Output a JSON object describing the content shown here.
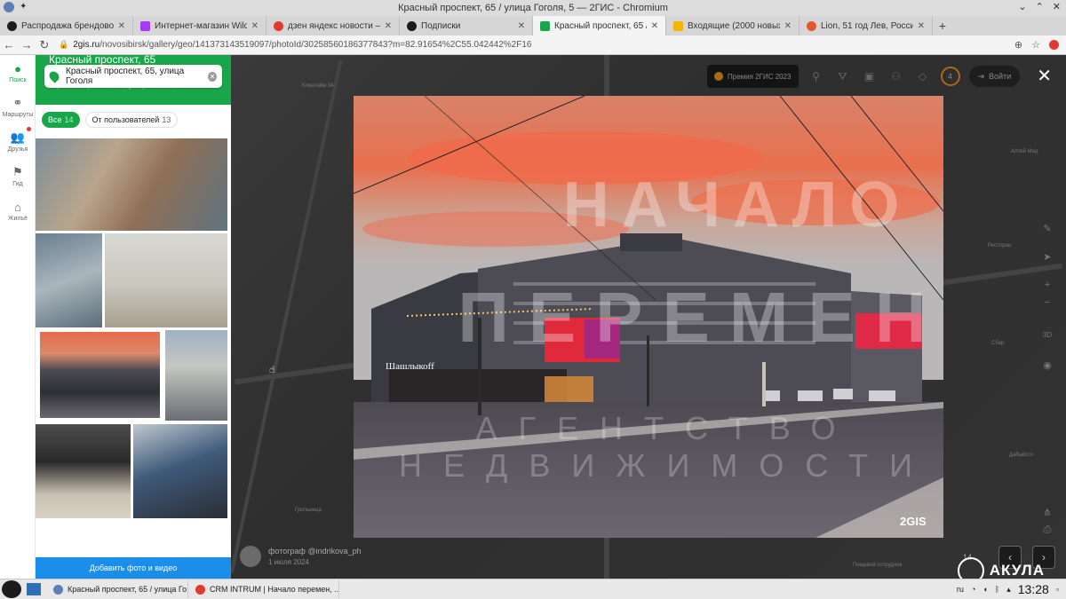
{
  "window": {
    "title": "Красный проспект, 65 / улица Гоголя, 5 — 2ГИС - Chromium"
  },
  "tabs": [
    {
      "label": "Распродажа брендовой од",
      "color": "#1c1c1c"
    },
    {
      "label": "Интернет-магазин Wildberr",
      "color": "#a73afd"
    },
    {
      "label": "дзен яндекс новости — Янд",
      "color": "#e0392e"
    },
    {
      "label": "Подписки",
      "color": "#1c1c1c"
    },
    {
      "label": "Красный проспект, 65 / ули",
      "color": "#19a64a",
      "active": true
    },
    {
      "label": "Входящие (2000 новых писе",
      "color": "#f5b400"
    },
    {
      "label": "Lion, 51 год Лев, Россия, Нов",
      "color": "#e05a2e"
    }
  ],
  "address": {
    "host": "2gis.ru",
    "path": "/novosibirsk/gallery/geo/141373143519097/photoId/30258560186377843?m=82.91654%2C55.042442%2F16"
  },
  "rail": [
    {
      "label": "Поиск",
      "icon": "search-pin-icon",
      "active": true
    },
    {
      "label": "Маршруты",
      "icon": "route-icon"
    },
    {
      "label": "Друзья",
      "icon": "friends-icon"
    },
    {
      "label": "Гид",
      "icon": "flag-icon"
    },
    {
      "label": "Жильё",
      "icon": "housing-icon"
    }
  ],
  "panel": {
    "title": "Красный проспект, 65",
    "search_value": "Красный проспект, 65, улица Гоголя",
    "sub": "Красный проспект, 65, улица Гоголя, 5",
    "filters": [
      {
        "label": "Все",
        "count": "14",
        "active": true
      },
      {
        "label": "От пользователей",
        "count": "13"
      }
    ],
    "add_button": "Добавить фото и видео"
  },
  "map": {
    "premium_label": "Премия 2ГИС 2023",
    "badge_count": "4",
    "login_label": "Войти",
    "labels": [
      "Клинтайм 34",
      "Алтей Мед",
      "Ресторан",
      "Сбер",
      "Грильница",
      "Дабыйсто",
      "Пищевой сотрудник"
    ]
  },
  "viewer": {
    "watermark_1": "НАЧАЛО",
    "watermark_2": "ПЕРЕМЕН",
    "watermark_3": "АГЕНТСТВО НЕДВИЖИМОСТИ",
    "photo_brand": "2GIS",
    "shop_sign": "Шашлыкоff",
    "credit_author": "фотограф @indrikova_ph",
    "credit_date": "1 июля 2024",
    "counter": "14",
    "akula": "АКУЛА"
  },
  "taskbar": {
    "tasks": [
      {
        "label": "Красный проспект, 65 / улица Го...",
        "color": "#5b7fb6"
      },
      {
        "label": "CRM INTRUM | Начало перемен, ...",
        "color": "#e0392e"
      }
    ],
    "lang": "ru",
    "time": "13:28"
  }
}
